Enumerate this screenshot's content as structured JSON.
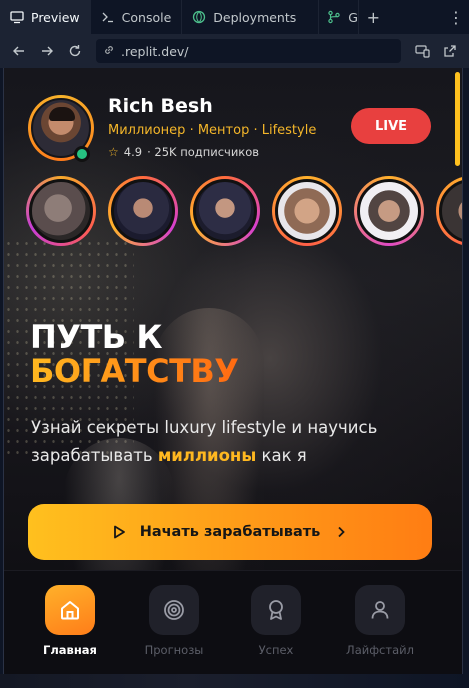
{
  "chrome": {
    "tabs": [
      {
        "label": "Preview",
        "icon": "monitor-icon",
        "active": true
      },
      {
        "label": "Console",
        "icon": "terminal-icon",
        "active": false
      },
      {
        "label": "Deployments",
        "icon": "globe-icon",
        "active": false
      },
      {
        "label": "G",
        "icon": "git-icon",
        "active": false
      }
    ],
    "url_host": ".replit.dev/",
    "url_path": ""
  },
  "profile": {
    "name": "Rich Besh",
    "roles": "Миллионер · Ментор · Lifestyle",
    "rating": "4.9",
    "subscribers": "· 25K подписчиков",
    "live_label": "LIVE"
  },
  "hero": {
    "title_line1": "ПУТЬ К",
    "title_line2": "БОГАТСТВУ",
    "subtitle_part1": "Узнай секреты luxury lifestyle и научись зарабатывать ",
    "subtitle_highlight": "миллионы",
    "subtitle_part2": " как я",
    "cta_label": "Начать зарабатывать"
  },
  "bottom_nav": [
    {
      "label": "Главная",
      "icon": "home-icon",
      "active": true
    },
    {
      "label": "Прогнозы",
      "icon": "target-icon",
      "active": false
    },
    {
      "label": "Успех",
      "icon": "award-icon",
      "active": false
    },
    {
      "label": "Лайфстайл",
      "icon": "user-icon",
      "active": false
    }
  ],
  "colors": {
    "accent_gold": "#ffb820",
    "accent_orange": "#ff7d13",
    "live_red": "#e8403f",
    "online_green": "#26c281"
  }
}
